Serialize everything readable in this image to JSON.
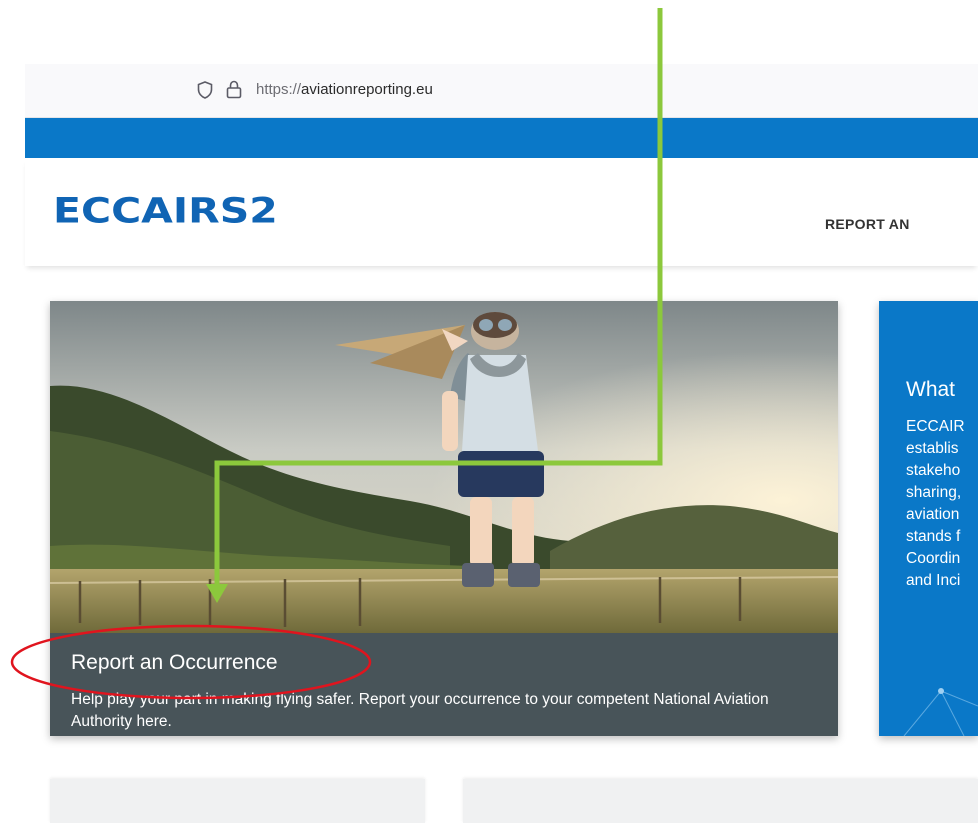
{
  "browser": {
    "url_scheme": "https://",
    "url_host": "aviationreporting.eu"
  },
  "header": {
    "logo_text": "ECCAIRS2",
    "nav_item": "REPORT AN"
  },
  "report_card": {
    "title": "Report an Occurrence",
    "description": "Help play your part in making flying safer. Report your occurrence to your competent National Aviation Authority here."
  },
  "what_card": {
    "title": "What",
    "lines": [
      "ECCAIR",
      "establis",
      "stakeho",
      "sharing,",
      "aviation",
      "stands f",
      "Coordin",
      "and Inci"
    ]
  },
  "colors": {
    "brand_blue": "#0a78c8",
    "logo_blue": "#1064b4",
    "caption_bg": "#485459",
    "annotation_green": "#8cc83c",
    "annotation_red": "#e0141e"
  }
}
